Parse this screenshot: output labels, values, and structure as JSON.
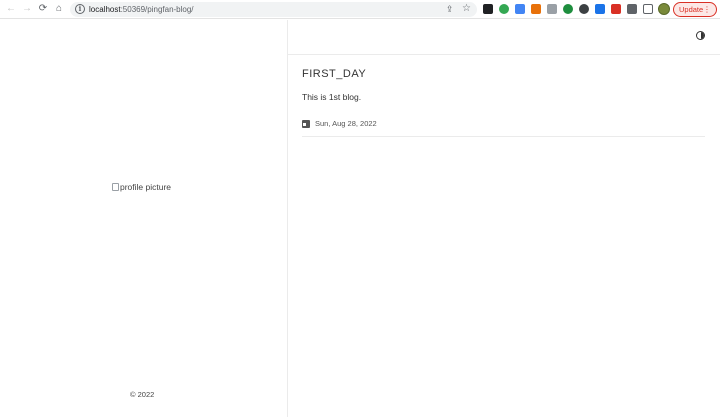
{
  "browser": {
    "url_host": "localhost",
    "url_rest": ":50369/pingfan-blog/",
    "update_label": "Update",
    "update_dots": "⋮",
    "icons": {
      "back": "←",
      "forward": "→",
      "reload": "⟳",
      "home": "⌂",
      "info": "i",
      "share": "⇪",
      "star": "☆"
    },
    "extensions": [
      {
        "name": "black-square",
        "color": "#202124"
      },
      {
        "name": "green-circle",
        "color": "#34a853"
      },
      {
        "name": "translate",
        "color": "#4285f4"
      },
      {
        "name": "orange",
        "color": "#e8710a"
      },
      {
        "name": "grey-k",
        "color": "#9aa0a6"
      },
      {
        "name": "green-check",
        "color": "#1e8e3e"
      },
      {
        "name": "dark-circle",
        "color": "#3c4043"
      },
      {
        "name": "blue-cap",
        "color": "#1a73e8"
      },
      {
        "name": "red-square",
        "color": "#d93025"
      }
    ]
  },
  "sidebar": {
    "profile_alt": "profile picture",
    "copyright": "© 2022"
  },
  "post": {
    "title": "FIRST_DAY",
    "summary": "This is 1st blog.",
    "date": "Sun, Aug 28, 2022"
  }
}
